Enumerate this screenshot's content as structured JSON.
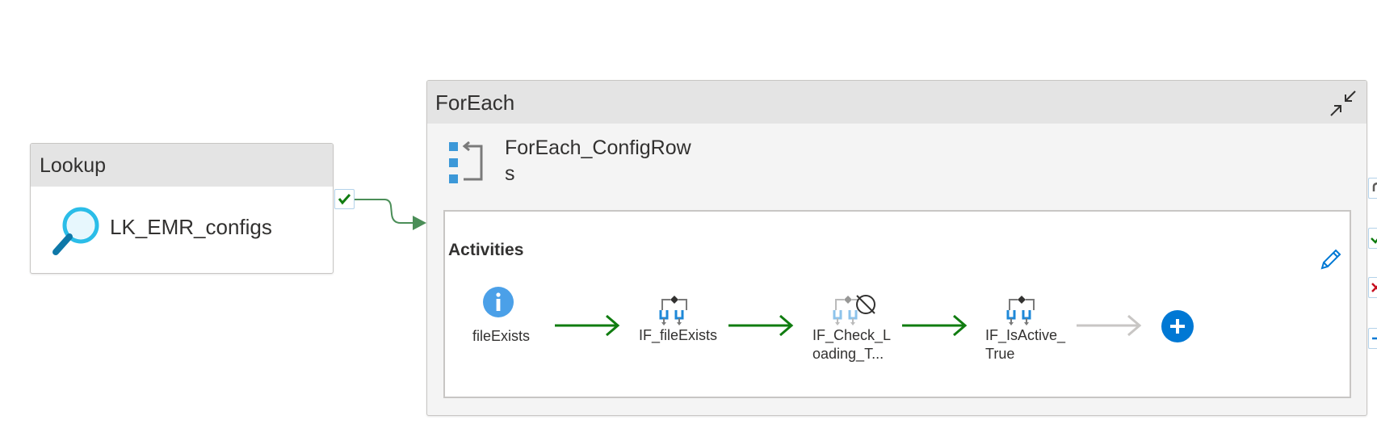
{
  "lookup": {
    "header": "Lookup",
    "name": "LK_EMR_configs"
  },
  "foreach": {
    "header": "ForEach",
    "name": "ForEach_ConfigRows",
    "name_line1": "ForEach_ConfigRow",
    "name_line2": "s",
    "activities_title": "Activities",
    "activities": [
      {
        "line1": "fileExists",
        "line2": ""
      },
      {
        "line1": "IF_fileExists",
        "line2": ""
      },
      {
        "line1": "IF_Check_L",
        "line2": "oading_T..."
      },
      {
        "line1": "IF_IsActive_",
        "line2": "True"
      }
    ]
  },
  "colors": {
    "success_arrow": "#107c10",
    "pending_arrow": "#c8c6c4",
    "lookup_link": "#4b8e58",
    "accent": "#0078d4",
    "icon_blue": "#4ba0e8"
  },
  "icons": {
    "lookup": "magnifier-icon",
    "foreach": "foreach-loop-icon",
    "get_metadata": "info-icon",
    "if_condition": "if-condition-icon",
    "deactivated": "deactivated-icon",
    "add": "add-icon",
    "edit": "pencil-icon",
    "collapse": "collapse-icon"
  }
}
